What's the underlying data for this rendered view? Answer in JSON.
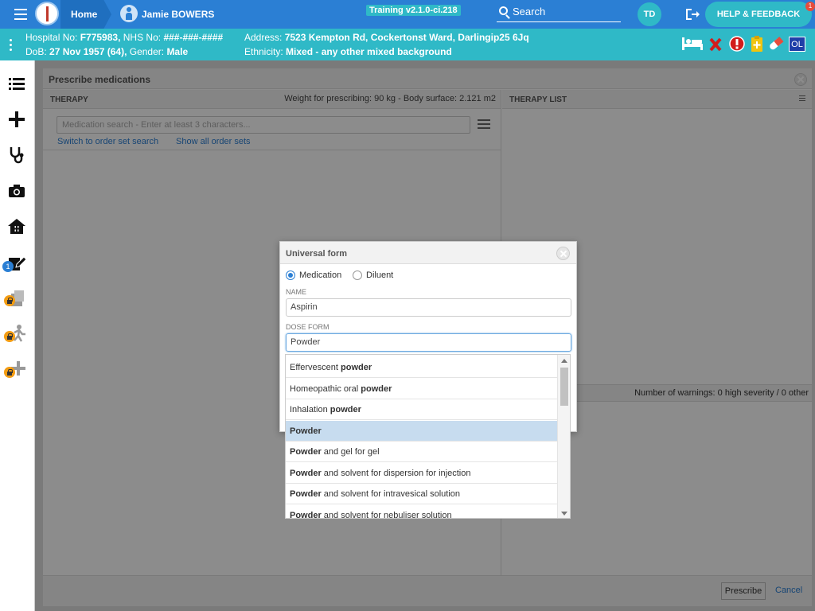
{
  "topbar": {
    "home_label": "Home",
    "patient_name": "Jamie BOWERS",
    "training": "Training v2.1.0-ci.218",
    "search_label": "Search",
    "avatar_initials": "TD",
    "help_label": "HELP & FEEDBACK",
    "notif_count": "1"
  },
  "patient": {
    "hosp_label": "Hospital No: ",
    "hosp_no": "F775983,",
    "nhs_label": " NHS No: ",
    "nhs_no": "###-###-####",
    "dob_label": "DoB: ",
    "dob": "27 Nov 1957 (64),",
    "gender_label": " Gender: ",
    "gender": "Male",
    "address_label": "Address: ",
    "address": "7523 Kempton Rd, Cockertonst Ward, Darlingip25 6Jq",
    "ethnicity_label": "Ethnicity: ",
    "ethnicity": "Mixed - any other mixed background",
    "ol_badge": "OL"
  },
  "sidebar": {
    "badge_count": "1"
  },
  "modal": {
    "title": "Prescribe medications",
    "therapy_header": "THERAPY",
    "weight_info": "Weight for prescribing: 90 kg - Body surface: 2.121 m2",
    "search_placeholder": "Medication search - Enter at least 3 characters...",
    "link_order_set_search": "Switch to order set search",
    "link_show_all": "Show all order sets",
    "therapy_list_header": "THERAPY LIST",
    "warnings": "Number of warnings: 0 high severity / 0 other",
    "prescribe_label": "Prescribe",
    "cancel_label": "Cancel"
  },
  "universal_form": {
    "title": "Universal form",
    "radio_medication": "Medication",
    "radio_diluent": "Diluent",
    "name_label": "NAME",
    "name_value": "Aspirin",
    "dose_form_label": "DOSE FORM",
    "dose_form_value": "Powder"
  },
  "dropdown": {
    "items": [
      {
        "pre": "Effervescent ",
        "bold": "powder",
        "post": ""
      },
      {
        "pre": "Homeopathic oral ",
        "bold": "powder",
        "post": ""
      },
      {
        "pre": "Inhalation ",
        "bold": "powder",
        "post": ""
      },
      {
        "pre": "",
        "bold": "Powder",
        "post": ""
      },
      {
        "pre": "",
        "bold": "Powder",
        "post": " and gel for gel"
      },
      {
        "pre": "",
        "bold": "Powder",
        "post": " and solvent for dispersion for injection"
      },
      {
        "pre": "",
        "bold": "Powder",
        "post": " and solvent for intravesical solution"
      },
      {
        "pre": "",
        "bold": "Powder",
        "post": " and solvent for nebuliser solution"
      }
    ],
    "selected_index": 3
  }
}
